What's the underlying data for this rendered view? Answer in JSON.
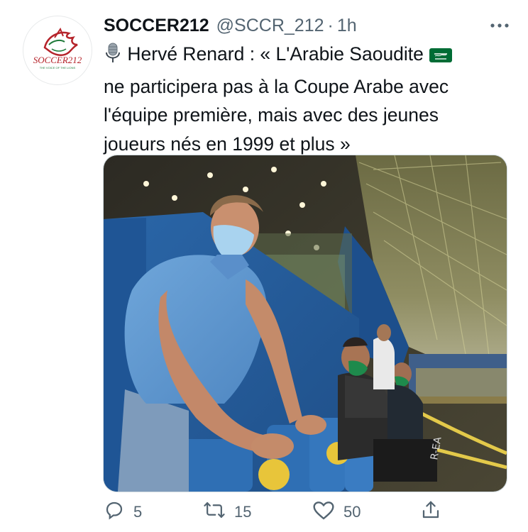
{
  "tweet": {
    "author": {
      "name": "SOCCER212",
      "handle": "@SCCR_212",
      "avatar_logo_text": "SOCCER212",
      "avatar_tagline": "THE VOICE OF THE LIONS"
    },
    "separator": "·",
    "time": "1h",
    "more_icon": "more-horizontal-icon",
    "text_lines": [
      "Hervé Renard : « L'Arabie Saoudite",
      "ne participera pas à la Coupe Arabe avec",
      "l'équipe première, mais avec des jeunes",
      "joueurs nés en 1999 et plus »"
    ],
    "emojis": [
      "microphone-emoji",
      "saudi-arabia-flag-emoji"
    ],
    "media": {
      "type": "photo",
      "description_icon": "stadium-photo"
    },
    "actions": {
      "reply": {
        "icon": "reply-icon",
        "count": "5"
      },
      "retweet": {
        "icon": "retweet-icon",
        "count": "15"
      },
      "like": {
        "icon": "heart-icon",
        "count": "50"
      },
      "share": {
        "icon": "share-icon",
        "count": ""
      }
    }
  },
  "colors": {
    "text_primary": "#0f1419",
    "text_secondary": "#536471",
    "border": "#cfd9de",
    "seat_blue": "#2f6fb4",
    "mask_green": "#1e8a4c"
  }
}
